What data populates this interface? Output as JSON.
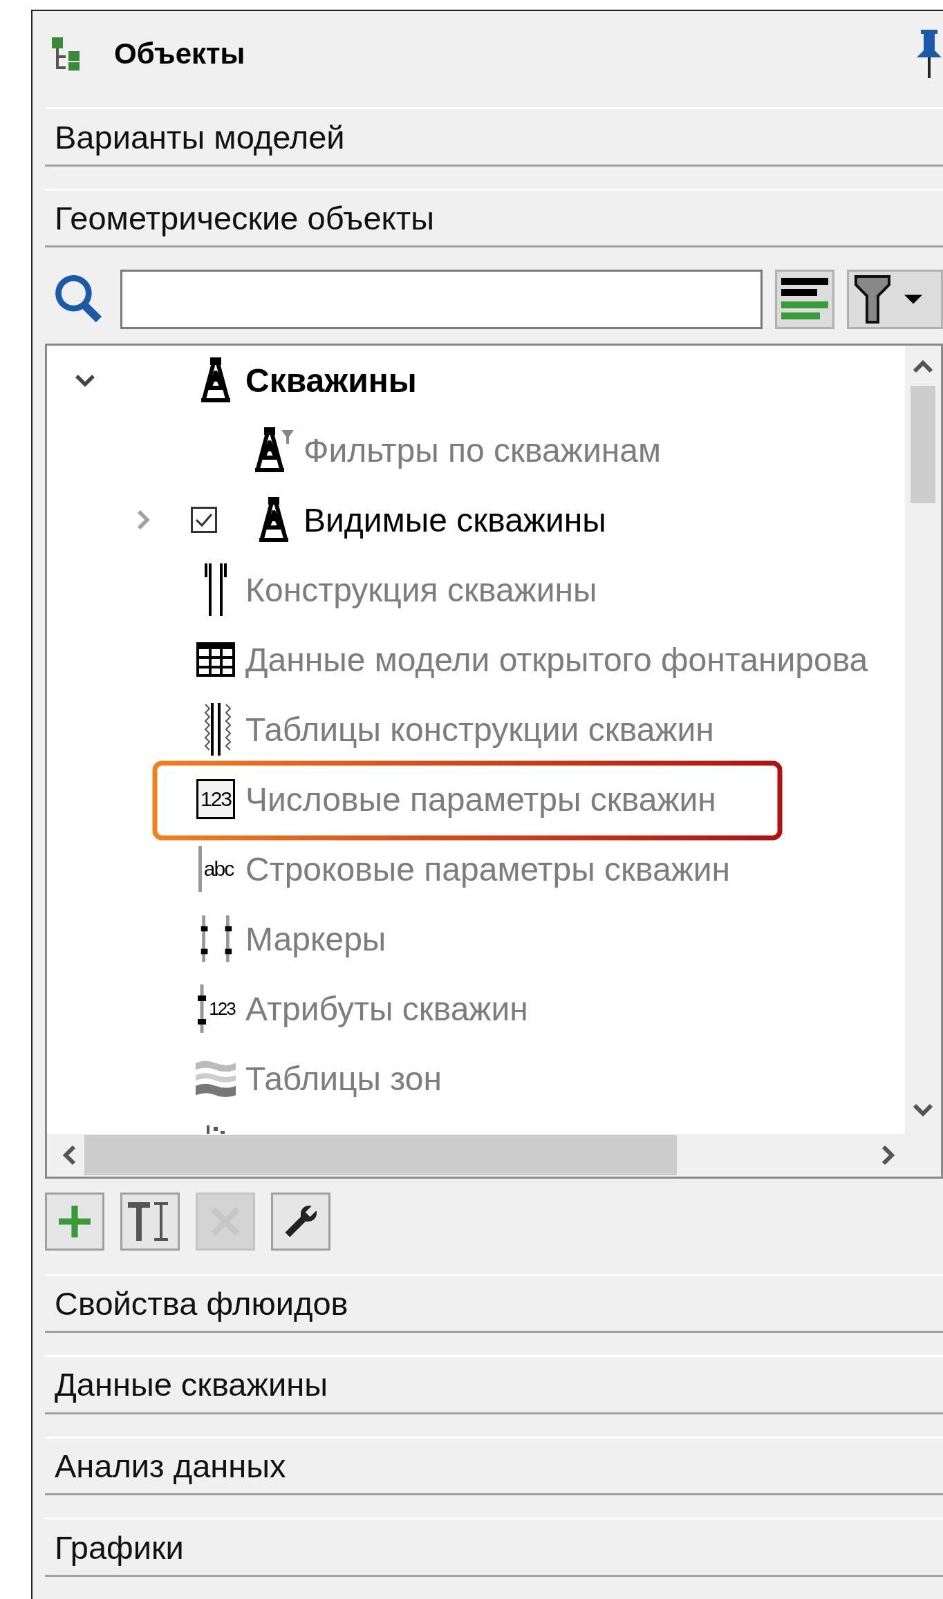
{
  "panel": {
    "title": "Объекты",
    "pinned": true
  },
  "sections_top": [
    {
      "label": "Варианты моделей"
    },
    {
      "label": "Геометрические объекты"
    }
  ],
  "tree": [
    {
      "label": "Скважины",
      "kind": "derrick",
      "disabled": false,
      "expanded": true,
      "children": [
        {
          "label": "Фильтры по скважинам",
          "kind": "derrick-filter",
          "disabled": true
        },
        {
          "label": "Видимые скважины",
          "kind": "derrick",
          "disabled": false,
          "expanded": false,
          "checked": true
        }
      ]
    },
    {
      "label": "Конструкция скважины",
      "kind": "casing",
      "disabled": true
    },
    {
      "label": "Данные модели открытого фонтанирова",
      "kind": "grid",
      "disabled": true
    },
    {
      "label": "Таблицы конструкции скважин",
      "kind": "zigzag",
      "disabled": true
    },
    {
      "label": "Числовые параметры скважин",
      "kind": "number",
      "icon_text": "123",
      "disabled": true,
      "highlighted": true
    },
    {
      "label": "Строковые параметры скважин",
      "kind": "string",
      "icon_text": "abc",
      "disabled": true
    },
    {
      "label": "Маркеры",
      "kind": "markers",
      "disabled": true
    },
    {
      "label": "Атрибуты скважин",
      "kind": "attributes",
      "icon_text": "123",
      "disabled": true
    },
    {
      "label": "Таблицы зон",
      "kind": "zones",
      "disabled": true
    },
    {
      "kind": "dots"
    }
  ],
  "toolbar": [
    {
      "kind": "add",
      "disabled": false
    },
    {
      "kind": "rename",
      "disabled": false
    },
    {
      "kind": "delete",
      "disabled": true
    },
    {
      "kind": "settings",
      "disabled": false
    }
  ],
  "sections_bottom": [
    {
      "label": "Свойства флюидов"
    },
    {
      "label": "Данные скважины"
    },
    {
      "label": "Анализ данных"
    },
    {
      "label": "Графики"
    }
  ]
}
